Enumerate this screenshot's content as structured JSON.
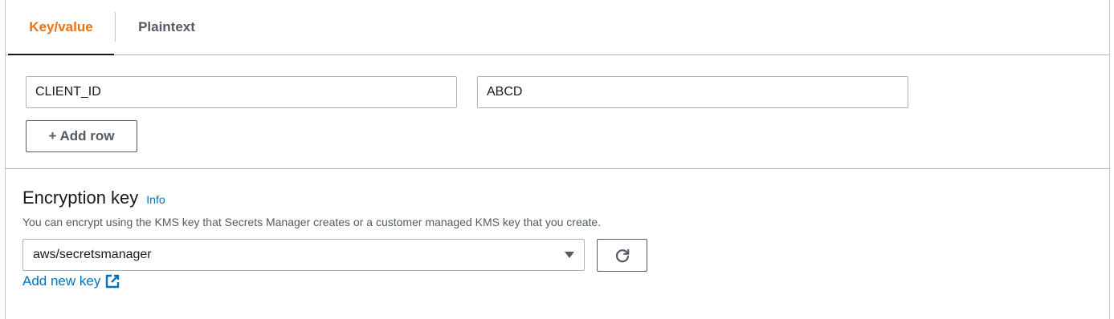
{
  "tabs": [
    {
      "label": "Key/value",
      "active": true
    },
    {
      "label": "Plaintext",
      "active": false
    }
  ],
  "kv_rows": [
    {
      "key": "CLIENT_ID",
      "value": "ABCD"
    }
  ],
  "add_row_label": "+ Add row",
  "encryption": {
    "title": "Encryption key",
    "info_label": "Info",
    "description": "You can encrypt using the KMS key that Secrets Manager creates or a customer managed KMS key that you create.",
    "selected_key": "aws/secretsmanager",
    "add_new_key_label": "Add new key"
  },
  "colors": {
    "active_tab": "#ec7211",
    "link": "#0073bb",
    "border": "#aab7b8"
  },
  "icons": {
    "caret": "caret-down-icon",
    "refresh": "refresh-icon",
    "external": "external-link-icon"
  }
}
